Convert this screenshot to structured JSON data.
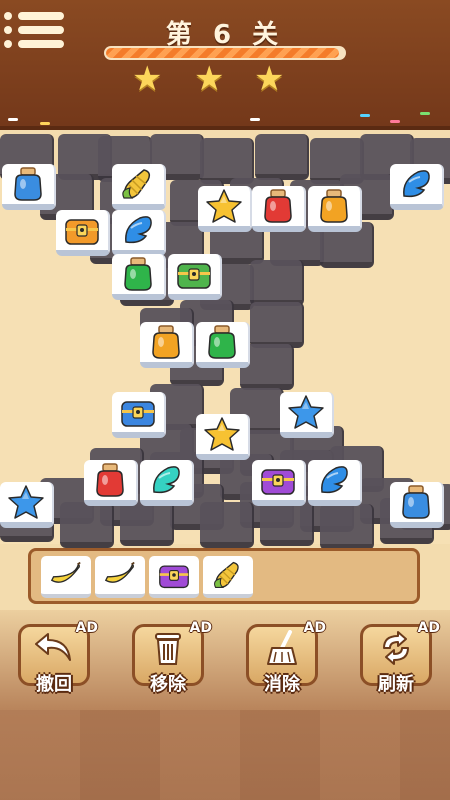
{
  "header": {
    "level_text": "第 6 关",
    "progress": 0.98,
    "stars_earned": 3,
    "stars_total": 3
  },
  "colors": {
    "header_bg": "#7a3d1c",
    "star": "#fcd65b",
    "progress_fill": "#f47c2a",
    "tile_face": "#ffffff",
    "tile_dim": "#59525b"
  },
  "board": {
    "top_tiles": [
      "jar-blue",
      "corn",
      "star-gold",
      "jar-red",
      "jar-orange",
      "feather-blue",
      "chest-orange",
      "feather-blue",
      "jar-green",
      "chest-green",
      "jar-orange",
      "jar-green",
      "chest-blue",
      "star-blue",
      "star-gold",
      "jar-red",
      "feather-teal",
      "chest-purple",
      "feather-blue",
      "star-blue",
      "jar-blue"
    ]
  },
  "tray": {
    "items": [
      "banana",
      "banana",
      "chest-purple",
      "corn"
    ],
    "capacity": 7
  },
  "tools": [
    {
      "label": "撤回",
      "badge": "AD",
      "icon": "undo-icon"
    },
    {
      "label": "移除",
      "badge": "AD",
      "icon": "trash-icon"
    },
    {
      "label": "消除",
      "badge": "AD",
      "icon": "broom-icon"
    },
    {
      "label": "刷新",
      "badge": "AD",
      "icon": "refresh-icon"
    }
  ]
}
